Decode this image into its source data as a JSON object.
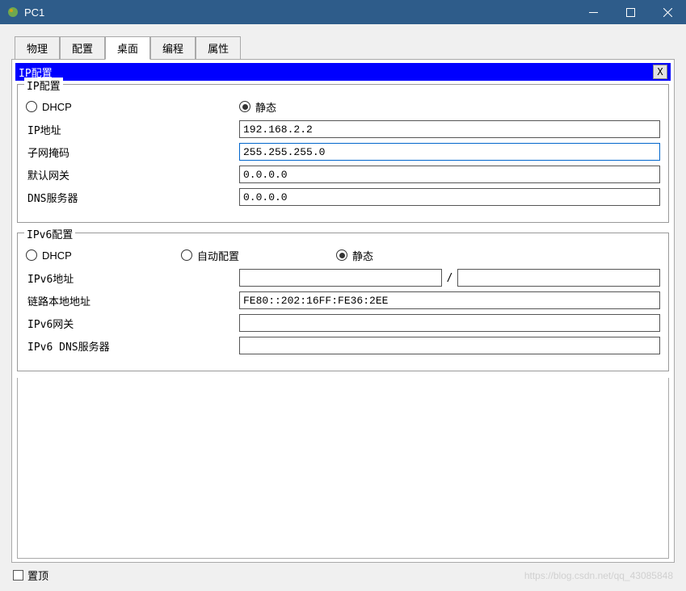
{
  "window": {
    "title": "PC1"
  },
  "tabs": {
    "physical": "物理",
    "config": "配置",
    "desktop": "桌面",
    "programming": "编程",
    "attributes": "属性"
  },
  "panel": {
    "title": "IP配置",
    "close": "X"
  },
  "ipv4": {
    "legend": "IP配置",
    "dhcp_label": "DHCP",
    "static_label": "静态",
    "ip_label": "IP地址",
    "ip_value": "192.168.2.2",
    "subnet_label": "子网掩码",
    "subnet_value": "255.255.255.0",
    "gateway_label": "默认网关",
    "gateway_value": "0.0.0.0",
    "dns_label": "DNS服务器",
    "dns_value": "0.0.0.0"
  },
  "ipv6": {
    "legend": "IPv6配置",
    "dhcp_label": "DHCP",
    "auto_label": "自动配置",
    "static_label": "静态",
    "addr_label": "IPv6地址",
    "addr_value": "",
    "prefix_value": "",
    "link_local_label": "链路本地地址",
    "link_local_value": "FE80::202:16FF:FE36:2EE",
    "gateway_label": "IPv6网关",
    "gateway_value": "",
    "dns_label": "IPv6 DNS服务器",
    "dns_value": "",
    "slash": "/"
  },
  "footer": {
    "always_on_top": "置顶",
    "watermark": "https://blog.csdn.net/qq_43085848"
  }
}
